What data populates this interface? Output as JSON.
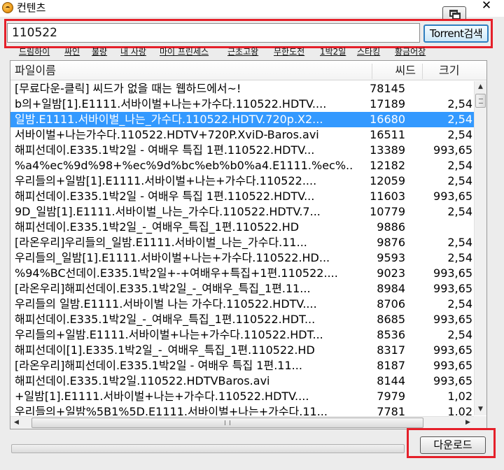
{
  "window": {
    "title": "컨텐츠",
    "close_label": "✕"
  },
  "search": {
    "value": "110522",
    "button_label": "Torrent검색"
  },
  "tags": [
    "드림하이",
    "싸인",
    "불량",
    "내 사랑",
    "마이 프린세스",
    "근초고왕",
    "무한도전",
    "1박2일",
    "스타킹",
    "황금어장"
  ],
  "table": {
    "columns": [
      "파일이름",
      "씨드",
      "크기"
    ],
    "rows": [
      {
        "name": "[무료다운-클릭] 씨드가 없을 때는 웹하드에서~!",
        "seed": "78145",
        "size": ""
      },
      {
        "name": "b의+일밤[1].E1111.서바이벌+나는+가수다.110522.HDTV....",
        "seed": "17189",
        "size": "2,54"
      },
      {
        "name": "일밤.E1111.서바이벌_나는_가수다.110522.HDTV.720p.X2...",
        "seed": "16680",
        "size": "2,54"
      },
      {
        "name": "서바이벌+나는가수다.110522.HDTV+720P.XviD-Baros.avi",
        "seed": "16511",
        "size": "2,54"
      },
      {
        "name": "해피선데이.E335.1박2일 - 여배우 특집 1편.110522.HDTV...",
        "seed": "13389",
        "size": "993,65"
      },
      {
        "name": "%a4%ec%9d%98+%ec%9d%bc%eb%b0%a4.E1111.%ec%...",
        "seed": "12182",
        "size": "2,54"
      },
      {
        "name": "우리들의+일밤[1].E1111.서바이벌+나는+가수다.110522....",
        "seed": "12059",
        "size": "2,54"
      },
      {
        "name": "해피선데이.E335.1박2일 - 여배우 특집 1편.110522.HDTV...",
        "seed": "11603",
        "size": "993,65"
      },
      {
        "name": "9D_일밤[1].E1111.서바이벌_나는_가수다.110522.HDTV.7...",
        "seed": "10779",
        "size": "2,54"
      },
      {
        "name": "해피선데이.E335.1박2일_-_여배우_특집_1편.110522.HD",
        "seed": "9886",
        "size": ""
      },
      {
        "name": "[라온우리]우리들의_일밤.E1111.서바이벌_나는_가수다.11...",
        "seed": "9876",
        "size": "2,54"
      },
      {
        "name": "우리들의_일밤[1].E1111.서바이벌+나는+가수다.110522.HD...",
        "seed": "9593",
        "size": "2,54"
      },
      {
        "name": "%94%BC선데이.E335.1박2일+-+여배우+특집+1편.110522....",
        "seed": "9023",
        "size": "993,65"
      },
      {
        "name": "[라온우리]해피선데이.E335.1박2일_-_여배우_특집_1편.11...",
        "seed": "8984",
        "size": "993,65"
      },
      {
        "name": "우리들의 일밤.E1111.서바이벌 나는 가수다.110522.HDTV....",
        "seed": "8706",
        "size": "2,54"
      },
      {
        "name": "해피선데이.E335.1박2일_-_여배우_특집_1편.110522.HDT...",
        "seed": "8685",
        "size": "993,65"
      },
      {
        "name": "우리들의+일밤.E1111.서바이벌+나는+가수다.110522.HDT...",
        "seed": "8536",
        "size": "2,54"
      },
      {
        "name": "해피선데이[1].E335.1박2일_-_여배우_특집_1편.110522.HD",
        "seed": "8317",
        "size": "993,65"
      },
      {
        "name": "[라온우리]해피선데이.E335.1박2일 - 여배우 특집 1편.11...",
        "seed": "8187",
        "size": "993,65"
      },
      {
        "name": "해피선데이.E335.1박2일.110522.HDTVBaros.avi",
        "seed": "8144",
        "size": "993,65"
      },
      {
        "name": "+일밤[1].E1111.서바이벌+나는+가수다.110522.HDTV....",
        "seed": "7979",
        "size": "1,02"
      },
      {
        "name": "우리들의+일밤%5B1%5D.E1111.서바이벌+나는+가수다.11...",
        "seed": "7781",
        "size": "1,02"
      }
    ],
    "selected_index": 2
  },
  "progress": {
    "fraction": 0.0
  },
  "download": {
    "button_label": "다운로드"
  },
  "colors": {
    "highlight": "#e5202a",
    "selection": "#3399ff",
    "torrent_button_border": "#2f7fc0"
  }
}
